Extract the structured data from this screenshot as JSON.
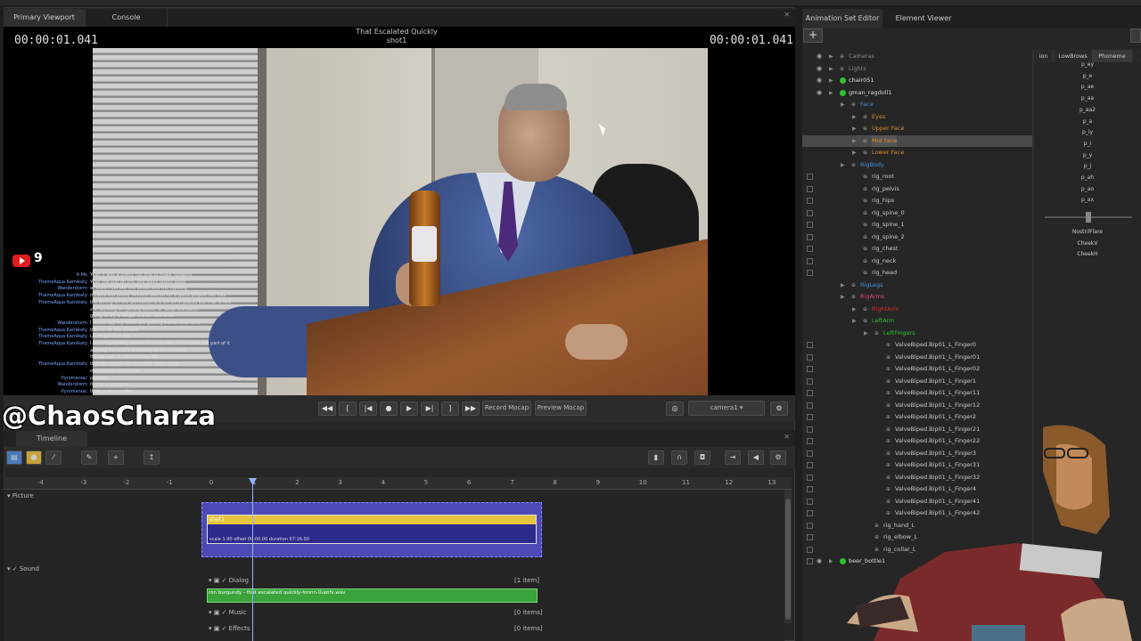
{
  "left_tabs": [
    "Primary Viewport",
    "Console"
  ],
  "viewport": {
    "timecode_left": "00:00:01.041",
    "timecode_right": "00:00:01.041",
    "title_line1": "That Escalated Quickly",
    "title_line2": "shot1"
  },
  "stream_overlay": {
    "viewer_count": "9",
    "watermark": "@ChaosCharza",
    "chat": [
      {
        "user": "A Mo",
        "text": "Yeah it was a pretty fun one to make honestly"
      },
      {
        "user": "ThemeAqua Kamikaty",
        "text": "Yeah the suit on this one looks pretty good"
      },
      {
        "user": "Wanderstorm",
        "text": "at least I did like the blinds and the lighting"
      },
      {
        "user": "ThemeAqua Kamikaty",
        "text": "it came out pretty smooth overall for a quick project like this"
      },
      {
        "user": "ThemeAqua Kamikaty",
        "text": "the timing on the animation is a bit off in places but that is fine"
      },
      {
        "user": "",
        "text": "still working on getting better at facial animation"
      },
      {
        "user": "",
        "text": "going to try a longer scene next time"
      },
      {
        "user": "Wanderstorm",
        "text": "I would say my faces are getting better over time"
      },
      {
        "user": "ThemeAqua Kamikaty",
        "text": "thanks for the stream"
      },
      {
        "user": "ThemeAqua Kamikaty",
        "text": "Looks good to me"
      },
      {
        "user": "ThemeAqua Kamikaty",
        "text": "I should probably render this out after I finish the last part of it"
      },
      {
        "user": "",
        "text": "anyway the audio is already in the timeline"
      },
      {
        "user": "",
        "text": "the lip sync is mostly done too"
      },
      {
        "user": "ThemeAqua Kamikaty",
        "text": "that the people on the chair looks good"
      },
      {
        "user": "",
        "text": "everything else is fine"
      },
      {
        "user": "Pyromaniac",
        "text": "peoples"
      },
      {
        "user": "Wanderstorm",
        "text": "it is a nice scene"
      },
      {
        "user": "Pyromaniac",
        "text": "thats a nice render"
      }
    ]
  },
  "transport": {
    "record_label": "Record Mocap",
    "preview_label": "Preview Mocap",
    "camera": "camera1"
  },
  "timeline": {
    "tab_label": "Timeline",
    "ruler_ticks": [
      "-4",
      "-3",
      "-2",
      "-1",
      "0",
      "1",
      "2",
      "3",
      "4",
      "5",
      "6",
      "7",
      "8",
      "9",
      "10",
      "11",
      "12",
      "13"
    ],
    "picture_label": "Picture",
    "clip_name": "shot1",
    "clip_info": "scale 1.00  offset  00:00.00  duration  07:16.00",
    "sound_label": "Sound",
    "dialog_label": "Dialog",
    "dialog_count": "[1 item]",
    "audio_clip": "ron burgundy - that escalated quickly-fonnn-0uothi.wav",
    "music_label": "Music",
    "music_count": "[0 items]",
    "effects_label": "Effects",
    "effects_count": "[0 items]"
  },
  "right_tabs": [
    "Animation Set Editor",
    "Element Viewer"
  ],
  "tree": [
    {
      "label": "Cameras",
      "color": "#888",
      "indent": 0,
      "eye": true,
      "arrow": true
    },
    {
      "label": "Lights",
      "color": "#888",
      "indent": 0,
      "eye": true,
      "arrow": true
    },
    {
      "label": "chair051",
      "color": "#ddd",
      "indent": 0,
      "eye": true,
      "arrow": true,
      "dot": true
    },
    {
      "label": "gman_ragdoll1",
      "color": "#ddd",
      "indent": 0,
      "eye": true,
      "arrow": true,
      "dot": true
    },
    {
      "label": "Face",
      "color": "#4a90e2",
      "indent": 1,
      "arrow": true
    },
    {
      "label": "Eyes",
      "color": "#e08a2a",
      "indent": 2,
      "arrow": true
    },
    {
      "label": "Upper Face",
      "color": "#e08a2a",
      "indent": 2,
      "arrow": true
    },
    {
      "label": "Mid Face",
      "color": "#e08a2a",
      "indent": 2,
      "arrow": true,
      "sel": true
    },
    {
      "label": "Lower Face",
      "color": "#e08a2a",
      "indent": 2,
      "arrow": true
    },
    {
      "label": "RigBody",
      "color": "#4a90e2",
      "indent": 1,
      "arrow": true
    },
    {
      "label": "rig_root",
      "color": "#ccc",
      "indent": 2,
      "chk": true
    },
    {
      "label": "rig_pelvis",
      "color": "#ccc",
      "indent": 2,
      "chk": true
    },
    {
      "label": "rig_hips",
      "color": "#ccc",
      "indent": 2,
      "chk": true
    },
    {
      "label": "rig_spine_0",
      "color": "#ccc",
      "indent": 2,
      "chk": true
    },
    {
      "label": "rig_spine_1",
      "color": "#ccc",
      "indent": 2,
      "chk": true
    },
    {
      "label": "rig_spine_2",
      "color": "#ccc",
      "indent": 2,
      "chk": true
    },
    {
      "label": "rig_chest",
      "color": "#ccc",
      "indent": 2,
      "chk": true
    },
    {
      "label": "rig_neck",
      "color": "#ccc",
      "indent": 2,
      "chk": true
    },
    {
      "label": "rig_head",
      "color": "#ccc",
      "indent": 2,
      "chk": true
    },
    {
      "label": "RigLegs",
      "color": "#4a90e2",
      "indent": 1,
      "arrow": true
    },
    {
      "label": "RigArms",
      "color": "#e0457a",
      "indent": 1,
      "arrow": true
    },
    {
      "label": "RightArm",
      "color": "#e02a2a",
      "indent": 2,
      "arrow": true
    },
    {
      "label": "LeftArm",
      "color": "#2ac12a",
      "indent": 2,
      "arrow": true
    },
    {
      "label": "LeftFingers",
      "color": "#2ac12a",
      "indent": 3,
      "arrow": true
    },
    {
      "label": "ValveBiped.Bip01_L_Finger0",
      "color": "#ccc",
      "indent": 4,
      "chk": true
    },
    {
      "label": "ValveBiped.Bip01_L_Finger01",
      "color": "#ccc",
      "indent": 4,
      "chk": true
    },
    {
      "label": "ValveBiped.Bip01_L_Finger02",
      "color": "#ccc",
      "indent": 4,
      "chk": true
    },
    {
      "label": "ValveBiped.Bip01_L_Finger1",
      "color": "#ccc",
      "indent": 4,
      "chk": true
    },
    {
      "label": "ValveBiped.Bip01_L_Finger11",
      "color": "#ccc",
      "indent": 4,
      "chk": true
    },
    {
      "label": "ValveBiped.Bip01_L_Finger12",
      "color": "#ccc",
      "indent": 4,
      "chk": true
    },
    {
      "label": "ValveBiped.Bip01_L_Finger2",
      "color": "#ccc",
      "indent": 4,
      "chk": true
    },
    {
      "label": "ValveBiped.Bip01_L_Finger21",
      "color": "#ccc",
      "indent": 4,
      "chk": true
    },
    {
      "label": "ValveBiped.Bip01_L_Finger22",
      "color": "#ccc",
      "indent": 4,
      "chk": true
    },
    {
      "label": "ValveBiped.Bip01_L_Finger3",
      "color": "#ccc",
      "indent": 4,
      "chk": true
    },
    {
      "label": "ValveBiped.Bip01_L_Finger31",
      "color": "#ccc",
      "indent": 4,
      "chk": true
    },
    {
      "label": "ValveBiped.Bip01_L_Finger32",
      "color": "#ccc",
      "indent": 4,
      "chk": true
    },
    {
      "label": "ValveBiped.Bip01_L_Finger4",
      "color": "#ccc",
      "indent": 4,
      "chk": true
    },
    {
      "label": "ValveBiped.Bip01_L_Finger41",
      "color": "#ccc",
      "indent": 4,
      "chk": true
    },
    {
      "label": "ValveBiped.Bip01_L_Finger42",
      "color": "#ccc",
      "indent": 4,
      "chk": true
    },
    {
      "label": "rig_hand_L",
      "color": "#ccc",
      "indent": 3,
      "chk": true
    },
    {
      "label": "rig_elbow_L",
      "color": "#ccc",
      "indent": 3,
      "chk": true
    },
    {
      "label": "rig_collar_L",
      "color": "#ccc",
      "indent": 3,
      "chk": true
    },
    {
      "label": "beer_bottle1",
      "color": "#ddd",
      "indent": 0,
      "eye": true,
      "arrow": true,
      "dot": true,
      "chk": true
    }
  ],
  "phoneme_tabs": [
    "ion",
    "LowBrows",
    "Phoneme"
  ],
  "phonemes": [
    "p_ey",
    "p_e",
    "p_ae",
    "p_aa",
    "p_aa2",
    "p_a",
    "p_iy",
    "p_i",
    "p_y",
    "p_j",
    "p_ah",
    "p_ao",
    "p_ax"
  ],
  "sliders": [
    "NostrilFlare",
    "CheekV",
    "CheekH"
  ]
}
